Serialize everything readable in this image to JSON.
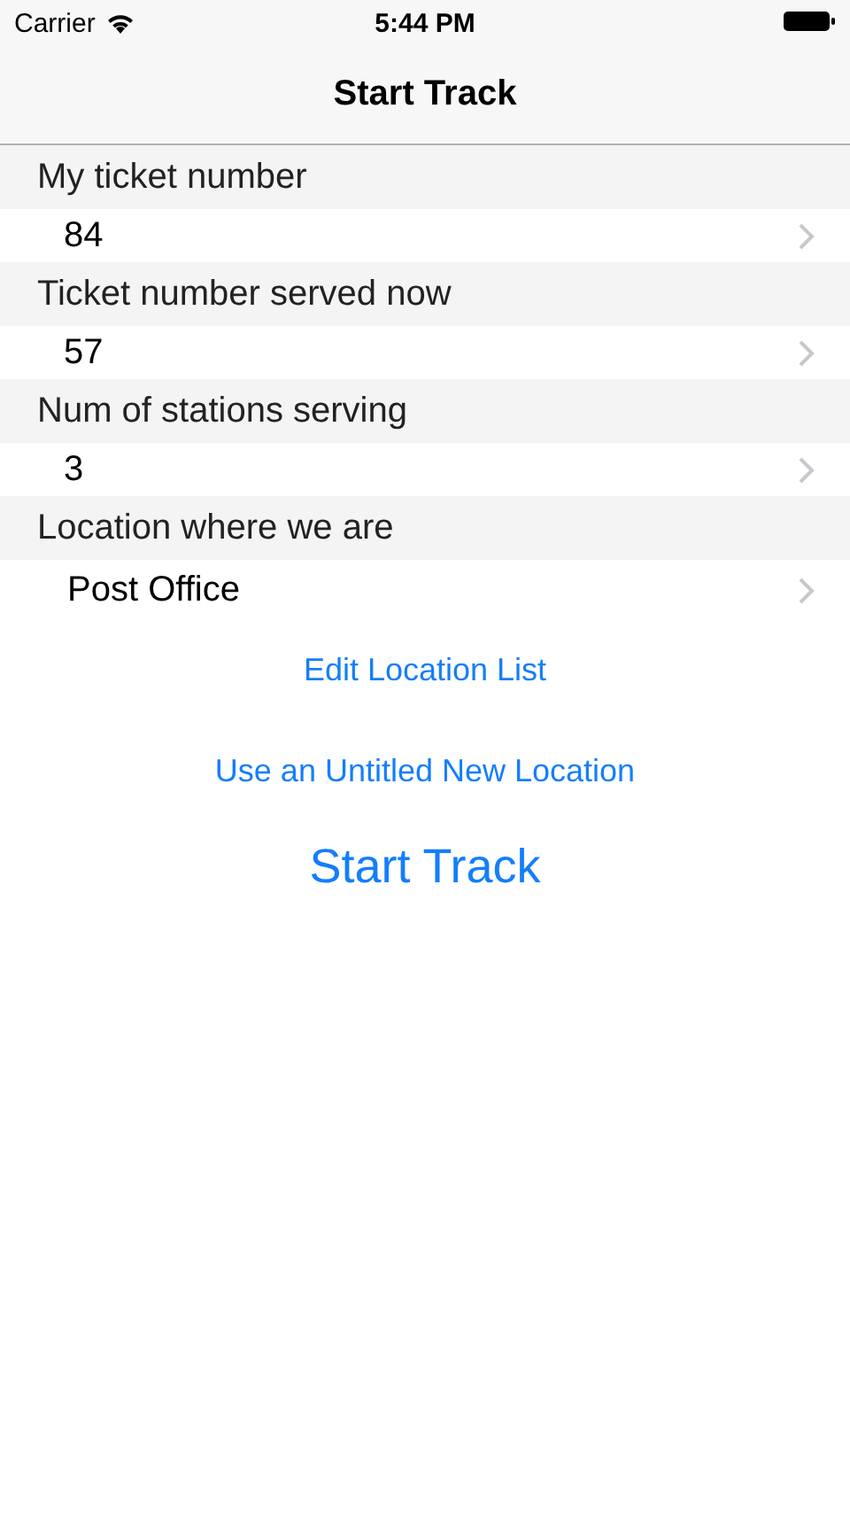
{
  "status_bar": {
    "carrier": "Carrier",
    "time": "5:44 PM"
  },
  "nav_bar": {
    "title": "Start Track"
  },
  "sections": [
    {
      "header": "My ticket number",
      "value": "84"
    },
    {
      "header": "Ticket number served now",
      "value": "57"
    },
    {
      "header": "Num of stations serving",
      "value": "3"
    },
    {
      "header": "Location where we are",
      "value": "Post Office"
    }
  ],
  "links": [
    "Edit Location List",
    "Use an Untitled New Location"
  ],
  "primary_button": "Start Track"
}
